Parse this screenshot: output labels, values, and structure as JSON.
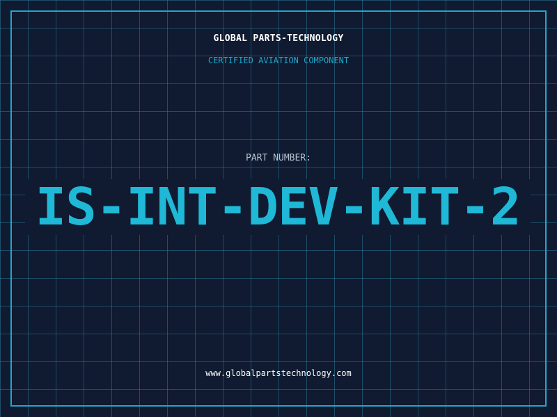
{
  "header": {
    "company": "GLOBAL PARTS-TECHNOLOGY",
    "subtitle": "CERTIFIED AVIATION COMPONENT"
  },
  "part": {
    "label": "PART NUMBER:",
    "number": "IS-INT-DEV-KIT-2"
  },
  "footer": {
    "website": "www.globalpartstechnology.com"
  },
  "colors": {
    "background": "#101a30",
    "grid": "#287896",
    "accent": "#1fb8d6",
    "frame": "#1fa8c9"
  }
}
